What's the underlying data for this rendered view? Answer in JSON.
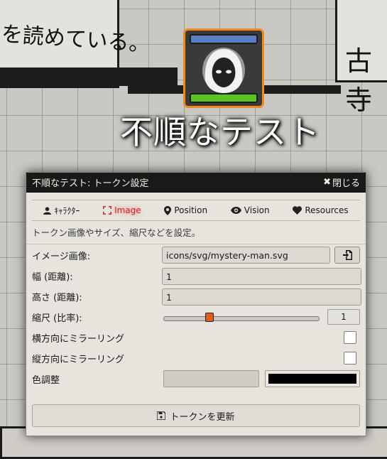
{
  "scene": {
    "background_text_left": "を読めている。",
    "background_text_right": "古寺"
  },
  "token": {
    "name": "不順なテスト",
    "frame_color": "#f08a18",
    "bar_top_color": "#5a7fc4",
    "bar_bottom_color": "#59c51d",
    "icon": "hooded-figure-icon"
  },
  "dialog": {
    "title": "不順なテスト: トークン設定",
    "close_label": "閉じる",
    "close_icon": "close-icon",
    "tabs": [
      {
        "label": "ｷｬﾗｸﾀｰ",
        "icon": "user-icon",
        "active": false
      },
      {
        "label": "Image",
        "icon": "expand-icon",
        "active": true
      },
      {
        "label": "Position",
        "icon": "map-pin-icon",
        "active": false
      },
      {
        "label": "Vision",
        "icon": "eye-icon",
        "active": false
      },
      {
        "label": "Resources",
        "icon": "heart-icon",
        "active": false
      }
    ],
    "hint": "トークン画像やサイズ、縮尺などを設定。",
    "fields": {
      "image_label": "イメージ画像:",
      "image_value": "icons/svg/mystery-man.svg",
      "width_label": "幅 (距離):",
      "width_value": "1",
      "height_label": "高さ (距離):",
      "height_value": "1",
      "scale_label": "縮尺 (比率):",
      "scale_value": "1",
      "scale_fraction": 0.3,
      "mirror_x_label": "横方向にミラーリング",
      "mirror_x_checked": false,
      "mirror_y_label": "縦方向にミラーリング",
      "mirror_y_checked": false,
      "tint_label": "色調整",
      "tint_value": "",
      "tint_color": "#000000"
    },
    "submit_label": "トークンを更新",
    "submit_icon": "save-icon"
  }
}
